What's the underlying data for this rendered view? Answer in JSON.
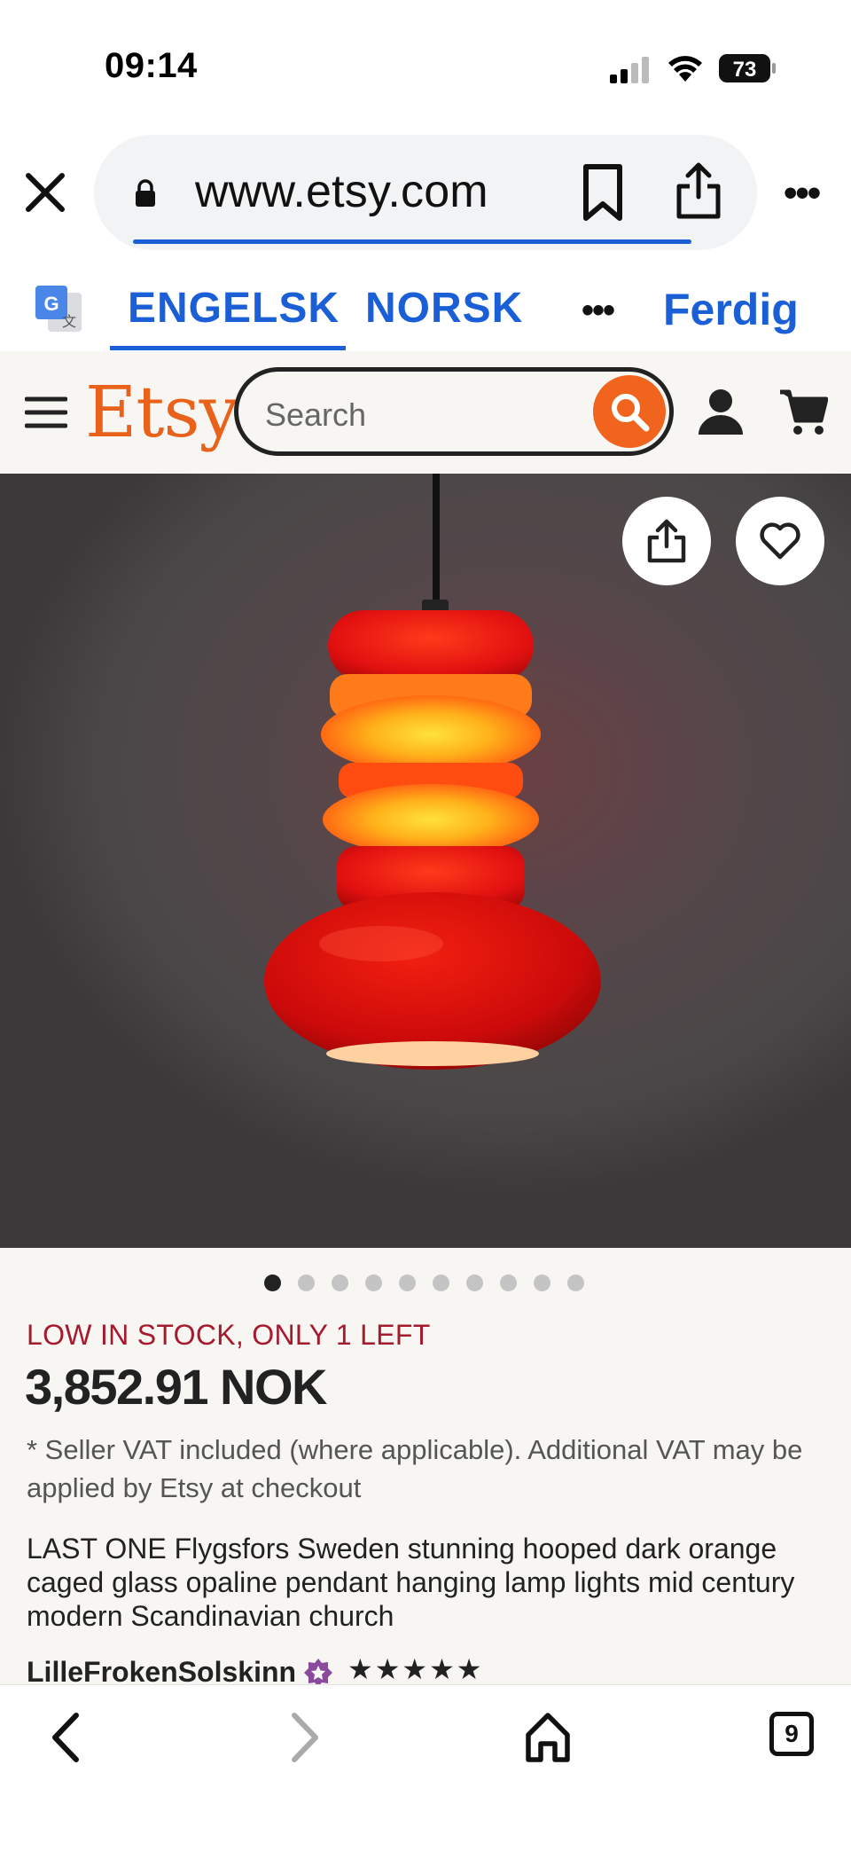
{
  "status_bar": {
    "time": "09:14",
    "battery": "73"
  },
  "browser": {
    "url": "www.etsy.com",
    "icons": [
      "close-icon",
      "lock-icon",
      "bookmark-icon",
      "share-icon",
      "more-icon"
    ]
  },
  "translate_bar": {
    "source_lang": "ENGELSK",
    "target_lang": "NORSK",
    "more": "•••",
    "done": "Ferdig"
  },
  "etsy_header": {
    "logo": "Etsy",
    "search_placeholder": "Search"
  },
  "listing": {
    "image_count": 10,
    "active_image_index": 0,
    "stock_notice": "LOW IN STOCK, ONLY 1 LEFT",
    "price": "3,852.91 NOK",
    "vat_note": "* Seller VAT included (where applicable). Additional VAT may be applied by Etsy at checkout",
    "title": "LAST ONE Flygsfors Sweden stunning hooped dark orange caged glass opaline pendant hanging lamp lights mid century modern Scandinavian church",
    "seller": "LilleFrokenSolskinn",
    "rating_stars": "★★★★★"
  },
  "bottom_nav": {
    "tab_count": "9"
  },
  "colors": {
    "etsy_orange": "#f1641e",
    "link_blue": "#1a5fd6",
    "stock_red": "#a61a2e"
  }
}
